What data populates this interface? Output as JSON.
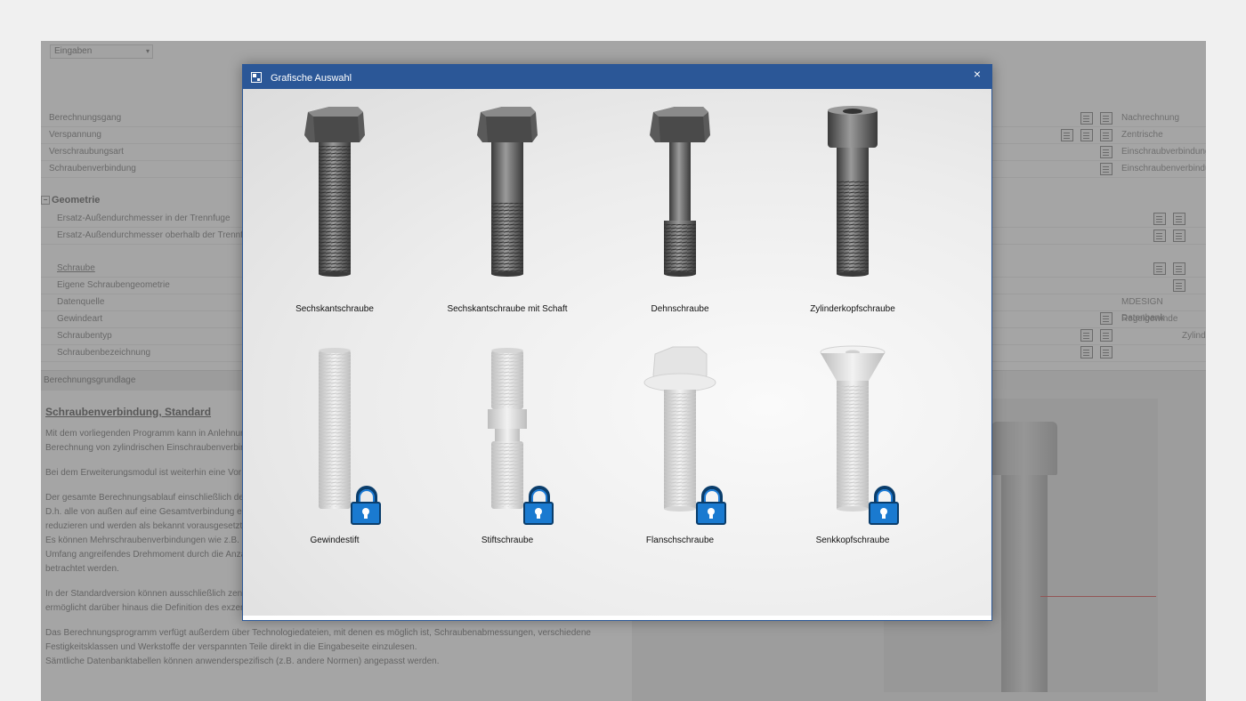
{
  "background_app": {
    "top_dropdown": "Eingaben",
    "rows": [
      {
        "label": "Berechnungsgang",
        "value": "Nachrechnung"
      },
      {
        "label": "Verspannung",
        "value": "Zentrische"
      },
      {
        "label": "Verschraubungsart",
        "value": "Einschraubverbindung"
      },
      {
        "label": "Schraubenverbindung",
        "value": "Einschraubenverbindung"
      }
    ],
    "geometry_group": "Geometrie",
    "geometry_rows": [
      {
        "label": "Ersatz-Außendurchmesser in der Trennfuge"
      },
      {
        "label": "Ersatz-Außendurchmesser oberhalb der Trennfuge"
      }
    ],
    "screw_rows": [
      {
        "label": "Schraube"
      },
      {
        "label": "Eigene Schraubengeometrie"
      },
      {
        "label": "Datenquelle",
        "value": "MDESIGN Datenbank"
      },
      {
        "label": "Gewindeart",
        "value": "Regelgewinde"
      },
      {
        "label": "Schraubentyp",
        "value": "Zylind"
      },
      {
        "label": "Schraubenbezeichnung"
      }
    ],
    "section_bar": "Berechnungsgrundlage",
    "doc_heading": "Schraubenverbindung, Standard",
    "doc_paragraphs": [
      "Mit dem vorliegenden Programm kann in Anlehnung\nBerechnung von zylindrischen Einschraubenverbin",
      "Bei dem Erweiterungsmodul ist weiterhin eine Vor",
      "Der gesamte Berechnungsablauf einschließlich der\nD.h. alle von außen auf eine Gesamtverbindung ei\nreduzieren und werden als bekannt vorausgesetzt\nEs können Mehrschraubenverbindungen wie z.B.\nUmfang angreifendes Drehmoment durch die Anza\nbetrachtet werden.",
      "In der Standardversion können ausschließlich zent\nermöglicht darüber hinaus die Definition des exzentrischen Verspannungs- und/oder Belastungsfalles.",
      "Das Berechnungsprogramm verfügt außerdem über Technologiedateien, mit denen es möglich ist, Schraubenabmessungen, verschiedene\nFestigkeitsklassen und Werkstoffe der verspannten Teile direkt in die Eingabeseite einzulesen.\nSämtliche Datenbanktabellen können anwenderspezifisch (z.B. andere Normen) angepasst werden."
    ]
  },
  "dialog": {
    "title": "Grafische Auswahl",
    "close_glyph": "×",
    "items": [
      {
        "label": "Sechskantschraube",
        "locked": false
      },
      {
        "label": "Sechskantschraube mit Schaft",
        "locked": false
      },
      {
        "label": "Dehnschraube",
        "locked": false
      },
      {
        "label": "Zylinderkopfschraube",
        "locked": false
      },
      {
        "label": "Gewindestift",
        "locked": true
      },
      {
        "label": "Stiftschraube",
        "locked": true
      },
      {
        "label": "Flanschschraube",
        "locked": true
      },
      {
        "label": "Senkkopfschraube",
        "locked": true
      }
    ]
  }
}
